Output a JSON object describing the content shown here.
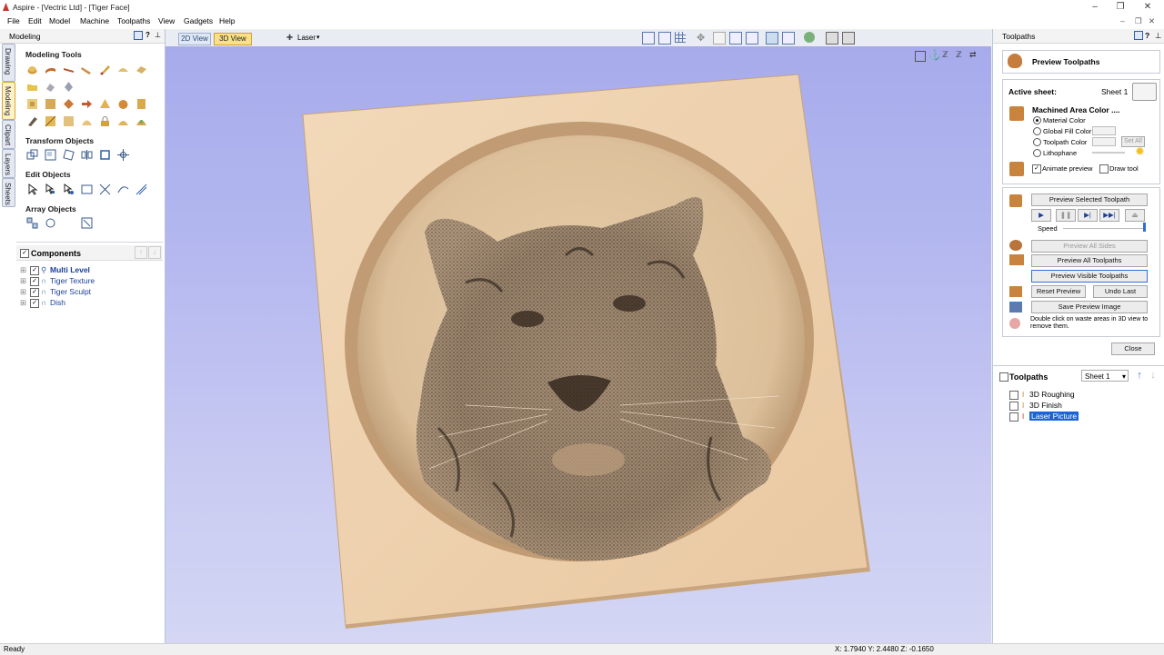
{
  "window": {
    "title": "Aspire - [Vectric Ltd] - [Tiger Face]"
  },
  "menu": [
    "File",
    "Edit",
    "Model",
    "Machine",
    "Toolpaths",
    "View",
    "Gadgets",
    "Help"
  ],
  "left_panel": {
    "title": "Modeling",
    "side_tabs": [
      "Drawing",
      "Modeling",
      "Clipart",
      "Layers",
      "Sheets"
    ],
    "sections": {
      "modeling_tools": "Modeling Tools",
      "transform_objects": "Transform Objects",
      "edit_objects": "Edit Objects",
      "array_objects": "Array Objects"
    },
    "components": {
      "title": "Components",
      "items": [
        "Multi Level",
        "Tiger Texture",
        "Tiger Sculpt",
        "Dish"
      ]
    }
  },
  "view_tabs": {
    "tab_2d": "2D View",
    "tab_3d": "3D View",
    "laser": "Laser"
  },
  "right_panel": {
    "title": "Toolpaths",
    "preview": {
      "heading": "Preview Toolpaths",
      "active_sheet_label": "Active sheet:",
      "active_sheet_value": "Sheet 1",
      "machined_area_color": "Machined Area Color ....",
      "options": [
        "Material Color",
        "Global Fill Color",
        "Toolpath Color",
        "Lithophane"
      ],
      "set_all": "Set All",
      "animate_preview": "Animate preview",
      "draw_tool": "Draw tool",
      "preview_selected": "Preview Selected Toolpath",
      "speed": "Speed",
      "preview_all_sides": "Preview All Sides",
      "preview_all_toolpaths": "Preview All Toolpaths",
      "preview_visible_toolpaths": "Preview Visible Toolpaths",
      "reset_preview": "Reset Preview",
      "undo_last": "Undo Last",
      "save_preview_image": "Save Preview Image",
      "hint": "Double click on waste areas in 3D view to remove them.",
      "close": "Close"
    },
    "toolpaths": {
      "title": "Toolpaths",
      "sheet": "Sheet 1",
      "items": [
        "3D Roughing",
        "3D Finish",
        "Laser Picture"
      ]
    }
  },
  "status": {
    "ready": "Ready",
    "coords": "X: 1.7940 Y: 2.4480 Z: -0.1650"
  }
}
